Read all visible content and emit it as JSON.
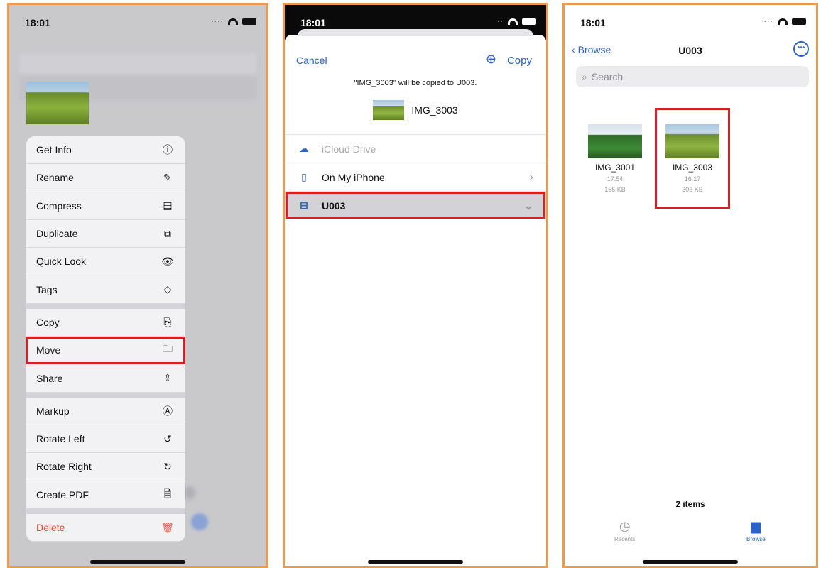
{
  "status": {
    "time": "18:01"
  },
  "panel1": {
    "menu_items": [
      {
        "label": "Get Info",
        "icon": "ⓘ",
        "icon_name": "info-icon"
      },
      {
        "label": "Rename",
        "icon": "✎",
        "icon_name": "pencil-icon"
      },
      {
        "label": "Compress",
        "icon": "▤",
        "icon_name": "archive-box-icon"
      },
      {
        "label": "Duplicate",
        "icon": "⧉",
        "icon_name": "duplicate-icon"
      },
      {
        "label": "Quick Look",
        "icon": "👁",
        "icon_name": "eye-icon"
      },
      {
        "label": "Tags",
        "icon": "◇",
        "icon_name": "tag-icon"
      },
      {
        "label": "Copy",
        "icon": "⎘",
        "icon_name": "copy-icon"
      },
      {
        "label": "Move",
        "icon": "🗀",
        "icon_name": "folder-icon"
      },
      {
        "label": "Share",
        "icon": "⇪",
        "icon_name": "share-icon"
      },
      {
        "label": "Markup",
        "icon": "Ⓐ",
        "icon_name": "markup-icon"
      },
      {
        "label": "Rotate Left",
        "icon": "↺",
        "icon_name": "rotate-left-icon"
      },
      {
        "label": "Rotate Right",
        "icon": "↻",
        "icon_name": "rotate-right-icon"
      },
      {
        "label": "Create PDF",
        "icon": "🗎",
        "icon_name": "pdf-icon"
      },
      {
        "label": "Delete",
        "icon": "🗑",
        "icon_name": "trash-icon"
      }
    ]
  },
  "panel2": {
    "cancel": "Cancel",
    "copy": "Copy",
    "info": "\"IMG_3003\" will be copied to U003.",
    "file_name": "IMG_3003",
    "locations": [
      {
        "label": "iCloud Drive",
        "icon": "☁"
      },
      {
        "label": "On My iPhone",
        "icon": "▯"
      },
      {
        "label": "U003",
        "icon": "⊟"
      }
    ]
  },
  "panel3": {
    "back": "Browse",
    "title": "U003",
    "search_placeholder": "Search",
    "files": [
      {
        "name": "IMG_3001",
        "time": "17:54",
        "size": "155 KB"
      },
      {
        "name": "IMG_3003",
        "time": "16:17",
        "size": "303 KB"
      }
    ],
    "count": "2 items",
    "tabs": [
      {
        "label": "Recents"
      },
      {
        "label": "Browse"
      }
    ]
  },
  "colors": {
    "accent": "#2a62c9",
    "highlight": "#d71f26",
    "frame": "#ec9a4e",
    "danger": "#e34a3c"
  }
}
